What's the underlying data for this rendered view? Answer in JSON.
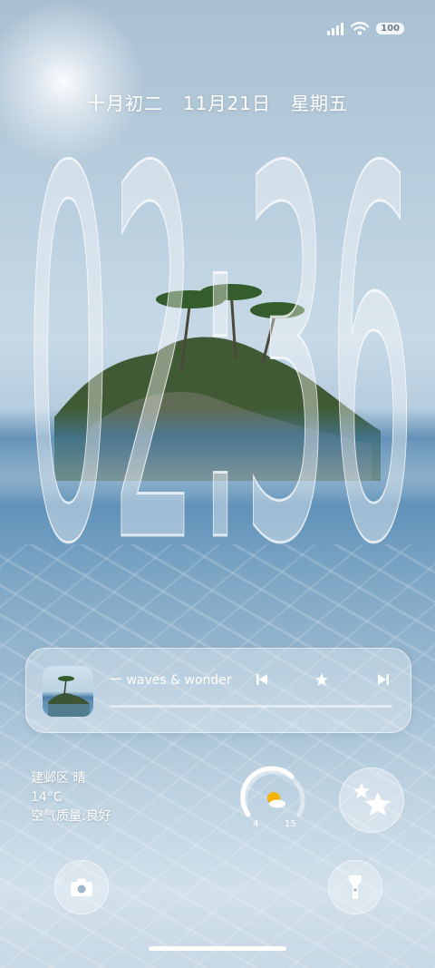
{
  "status": {
    "battery": "100",
    "icons": [
      "signal-icon",
      "wifi-icon",
      "battery-icon"
    ]
  },
  "date": {
    "lunar": "十月初二",
    "solar": "11月21日",
    "weekday": "星期五"
  },
  "clock": {
    "time": "02:36"
  },
  "music": {
    "track": "一 waves & wonder",
    "icons": [
      "prev-icon",
      "favorite-star-icon",
      "next-icon"
    ]
  },
  "weather": {
    "location": "建邺区 晴",
    "temperature": "14°C",
    "air_quality": "空气质量:良好"
  },
  "weather_gauge": {
    "low": "4",
    "high": "15",
    "icon": "sun-cloud-icon"
  },
  "shortcuts": {
    "left": "camera-icon",
    "right": "flashlight-icon",
    "widget": "stars-icon"
  },
  "colors": {
    "accent_white": "#ffffff",
    "sun_icon": "#f5b300",
    "glass": "rgba(255,255,255,0.32)"
  }
}
